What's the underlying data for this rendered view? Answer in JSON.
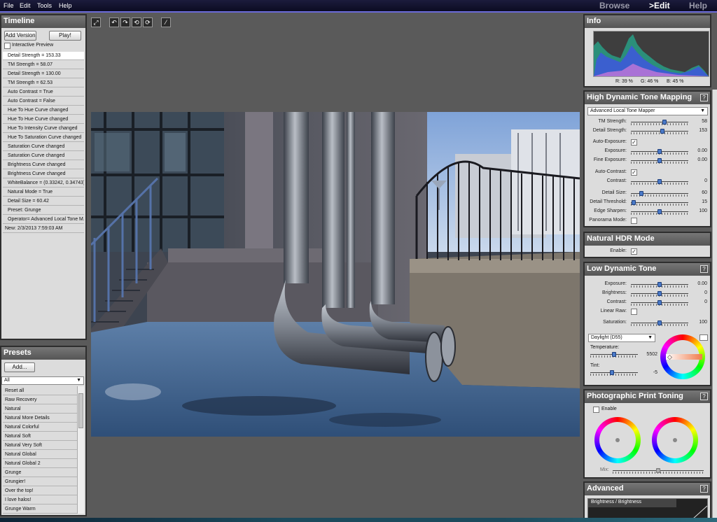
{
  "menu": [
    "File",
    "Edit",
    "Tools",
    "Help"
  ],
  "nav": {
    "browse": "Browse",
    "edit": ">Edit",
    "help": "Help"
  },
  "timeline": {
    "title": "Timeline",
    "add_version": "Add Version",
    "play": "Play!",
    "interactive_preview": "Interactive Preview",
    "items": [
      "Detail Strength = 153.33",
      "TM Strength = 58.07",
      "Detail Strength = 130.00",
      "TM Strength = 62.53",
      "Auto Contrast = True",
      "Auto Contrast = False",
      "Hue To Hue Curve changed",
      "Hue To Hue Curve changed",
      "Hue To Intensity Curve changed",
      "Hue To Saturation Curve changed",
      "Saturation Curve changed",
      "Saturation Curve changed",
      "Brightness Curve changed",
      "Brightness Curve changed",
      "WhiteBalance = (0.33242, 0.34743)",
      "Natural Mode = True",
      "Detail Size = 60.42",
      "Preset: Grunge",
      "Operator= Advanced Local Tone M...",
      "New: 2/3/2013 7:59:03 AM"
    ]
  },
  "presets": {
    "title": "Presets",
    "add": "Add...",
    "filter": "All",
    "items": [
      "Reset all",
      "Raw Recovery",
      "Natural",
      "Natural More Details",
      "Natural Colorful",
      "Natural Soft",
      "Natural Very Soft",
      "Natural Global",
      "Natural Global 2",
      "Grunge",
      "Grungier!",
      "Over the top!",
      "I love halos!",
      "Grunge Warm"
    ]
  },
  "info": {
    "title": "Info",
    "r": "R: 39 %",
    "g": "G: 46 %",
    "b": "B: 45 %"
  },
  "hdr": {
    "title": "High Dynamic Tone Mapping",
    "help": "?",
    "operator": "Advanced Local Tone Mapper",
    "tm_strength": {
      "label": "TM Strength:",
      "value": "58",
      "level": 0.58
    },
    "detail_strength": {
      "label": "Detail Strength:",
      "value": "153",
      "level": 0.55
    },
    "auto_exposure": {
      "label": "Auto-Exposure:",
      "checked": "✓"
    },
    "exposure": {
      "label": "Exposure:",
      "value": "0.00",
      "level": 0.5
    },
    "fine_exposure": {
      "label": "Fine Exposure:",
      "value": "0.00",
      "level": 0.5
    },
    "auto_contrast": {
      "label": "Auto-Contrast:",
      "checked": "✓"
    },
    "contrast": {
      "label": "Contrast:",
      "value": "0",
      "level": 0.5
    },
    "detail_size": {
      "label": "Detail Size:",
      "value": "60",
      "level": 0.18
    },
    "detail_threshold": {
      "label": "Detail Threshold:",
      "value": "15",
      "level": 0.05
    },
    "edge_sharpen": {
      "label": "Edge Sharpen:",
      "value": "100",
      "level": 0.5
    },
    "panorama_mode": {
      "label": "Panorama Mode:"
    }
  },
  "natural": {
    "title": "Natural HDR Mode",
    "enable": {
      "label": "Enable:",
      "checked": "✓"
    }
  },
  "ldr": {
    "title": "Low Dynamic Tone",
    "help": "?",
    "exposure": {
      "label": "Exposure:",
      "value": "0.00",
      "level": 0.5
    },
    "brightness": {
      "label": "Brightness:",
      "value": "0",
      "level": 0.5
    },
    "contrast": {
      "label": "Contrast:",
      "value": "0",
      "level": 0.5
    },
    "linear_raw": {
      "label": "Linear Raw:"
    },
    "saturation": {
      "label": "Saturation:",
      "value": "100",
      "level": 0.5
    },
    "wb_preset": "Daylight (D55)",
    "temperature": {
      "label": "Temperature:",
      "value": "5502",
      "level": 0.5
    },
    "tint": {
      "label": "Tint:",
      "value": "-5",
      "level": 0.45
    }
  },
  "print_toning": {
    "title": "Photographic Print Toning",
    "help": "?",
    "enable": "Enable",
    "mix": "Mix:"
  },
  "advanced": {
    "title": "Advanced",
    "help": "?",
    "tab": "Brightness / Brightness"
  },
  "colors": {
    "accent": "#4a7ac8",
    "panel_bg": "#dcdcdc",
    "header": "#666666"
  }
}
